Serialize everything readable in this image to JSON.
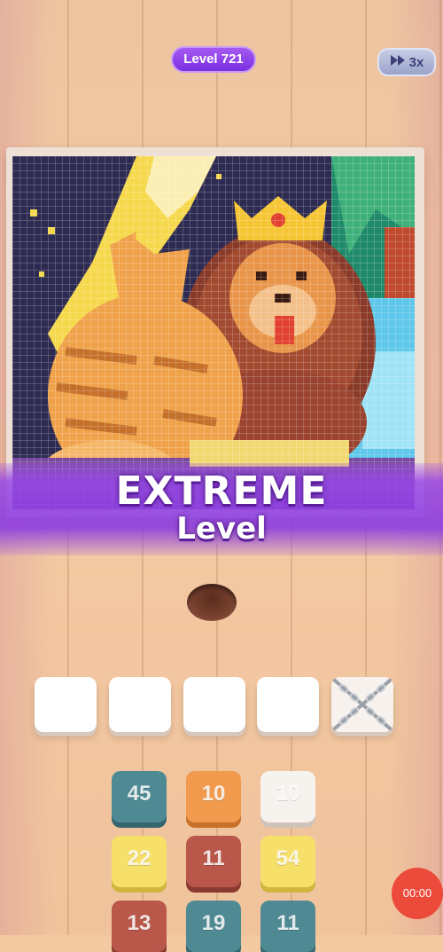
{
  "header": {
    "level_label": "Level 721",
    "speed_label": "3x",
    "speed_icon": "fast-forward-icon"
  },
  "artwork": {
    "subject": "pixel-art",
    "grid": "on"
  },
  "banner": {
    "title": "EXTREME",
    "subtitle": "Level"
  },
  "slots": [
    {
      "state": "empty"
    },
    {
      "state": "empty"
    },
    {
      "state": "empty"
    },
    {
      "state": "empty"
    },
    {
      "state": "locked",
      "icon": "chain-lock-icon"
    }
  ],
  "tiles": [
    {
      "value": "45",
      "color": "#4f8a94",
      "shade": "#356670"
    },
    {
      "value": "10",
      "color": "#f29a4d",
      "shade": "#c7712c"
    },
    {
      "value": "10",
      "color": "#f6f2ee",
      "shade": "#cfc3b9"
    },
    {
      "value": "22",
      "color": "#f6e06a",
      "shade": "#cfb43d"
    },
    {
      "value": "11",
      "color": "#b8574a",
      "shade": "#8c3a30"
    },
    {
      "value": "54",
      "color": "#f6e06a",
      "shade": "#cfb43d"
    },
    {
      "value": "13",
      "color": "#b8574a",
      "shade": "#8c3a30"
    },
    {
      "value": "19",
      "color": "#4f8a94",
      "shade": "#356670"
    },
    {
      "value": "11",
      "color": "#4f8a94",
      "shade": "#356670"
    }
  ],
  "recorder": {
    "time": "00:00"
  }
}
